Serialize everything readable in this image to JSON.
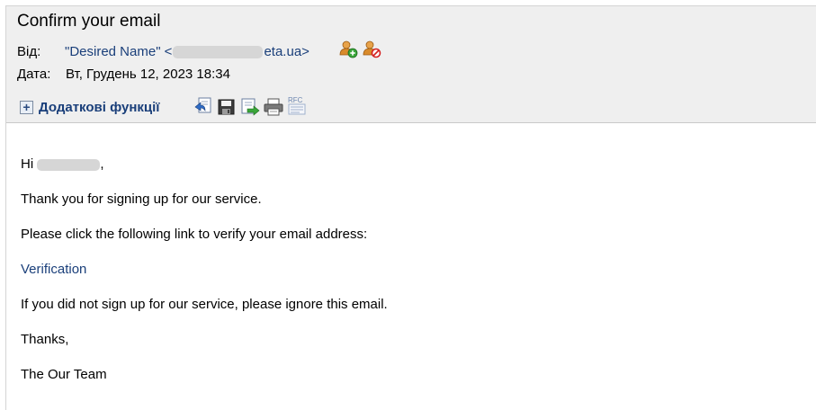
{
  "message": {
    "subject": "Confirm your email",
    "from_label": "Від:",
    "from_name": "\"Desired Name\" <",
    "from_domain_tail": "eta.ua>",
    "date_label": "Дата:",
    "date_value": "Вт, Грудень 12, 2023 18:34"
  },
  "toolbar": {
    "extras_label": "Додаткові функції",
    "rfc_label": "RFC"
  },
  "body": {
    "greeting_start": "Hi ",
    "greeting_end": ",",
    "line1": "Thank you for signing up for our service.",
    "line2": "Please click the following link to verify your email address:",
    "link_text": "Verification",
    "line3": "If you did not sign up for our service, please ignore this email.",
    "line4": "Thanks,",
    "line5": "The Our Team"
  },
  "icons": [
    "add-contact-icon",
    "block-contact-icon",
    "plus-icon",
    "reply-icon",
    "save-icon",
    "forward-icon",
    "print-icon",
    "rfc-icon"
  ]
}
